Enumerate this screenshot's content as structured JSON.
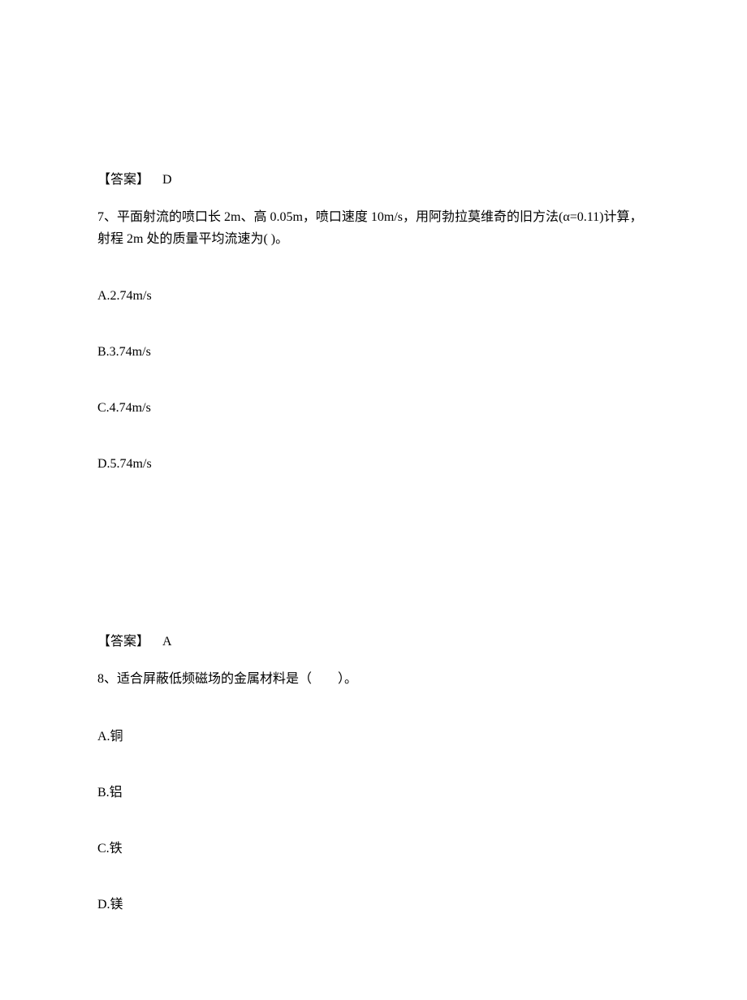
{
  "block1": {
    "answer_label": "【答案】",
    "answer_value": "D"
  },
  "q7": {
    "prefix": "7、",
    "text": "平面射流的喷口长 2m、高 0.05m，喷口速度 10m/s，用阿勃拉莫维奇的旧方法(α=0.11)计算，射程 2m 处的质量平均流速为( )。",
    "optA": "A.2.74m/s",
    "optB": "B.3.74m/s",
    "optC": "C.4.74m/s",
    "optD": "D.5.74m/s"
  },
  "block2": {
    "answer_label": "【答案】",
    "answer_value": "A"
  },
  "q8": {
    "prefix": "8、",
    "text": "适合屏蔽低频磁场的金属材料是（　　）。",
    "optA": "A.铜",
    "optB": "B.铝",
    "optC": "C.铁",
    "optD": "D.镁"
  }
}
